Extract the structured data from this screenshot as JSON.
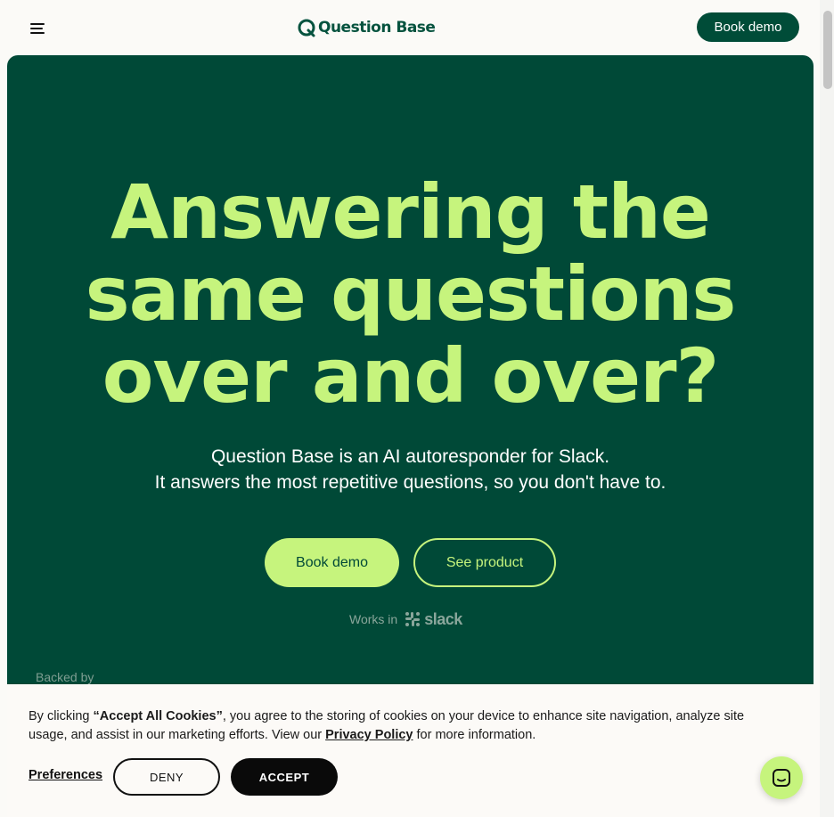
{
  "header": {
    "logo_text": "Question Base",
    "book_demo_label": "Book demo"
  },
  "hero": {
    "headline_line1": "Answering the",
    "headline_line2": "same questions",
    "headline_line3": "over and over?",
    "subtitle_line1": "Question Base is an AI autoresponder for Slack.",
    "subtitle_line2": "It answers the most repetitive questions, so you don't have to.",
    "primary_button": "Book demo",
    "secondary_button": "See product",
    "works_in": "Works in",
    "slack_wordmark": "slack",
    "backed_by": "Backed by"
  },
  "cookie_banner": {
    "text_prefix": "By clicking ",
    "text_bold": "“Accept All Cookies”",
    "text_middle": ", you agree to the storing of cookies on your device to enhance site navigation, analyze site usage, and assist in our marketing efforts. View our ",
    "privacy_link": "Privacy Policy",
    "text_suffix": " for more information.",
    "preferences_label": "Preferences",
    "deny_label": "DENY",
    "accept_label": "ACCEPT"
  },
  "colors": {
    "brand_dark_green": "#004937",
    "brand_lime": "#c6f47d",
    "logo_green": "#06533f"
  },
  "icons": {
    "menu": "hamburger-menu-icon",
    "logo": "question-base-logo-icon",
    "slack": "slack-logo-icon",
    "chat": "chat-bubble-icon"
  }
}
